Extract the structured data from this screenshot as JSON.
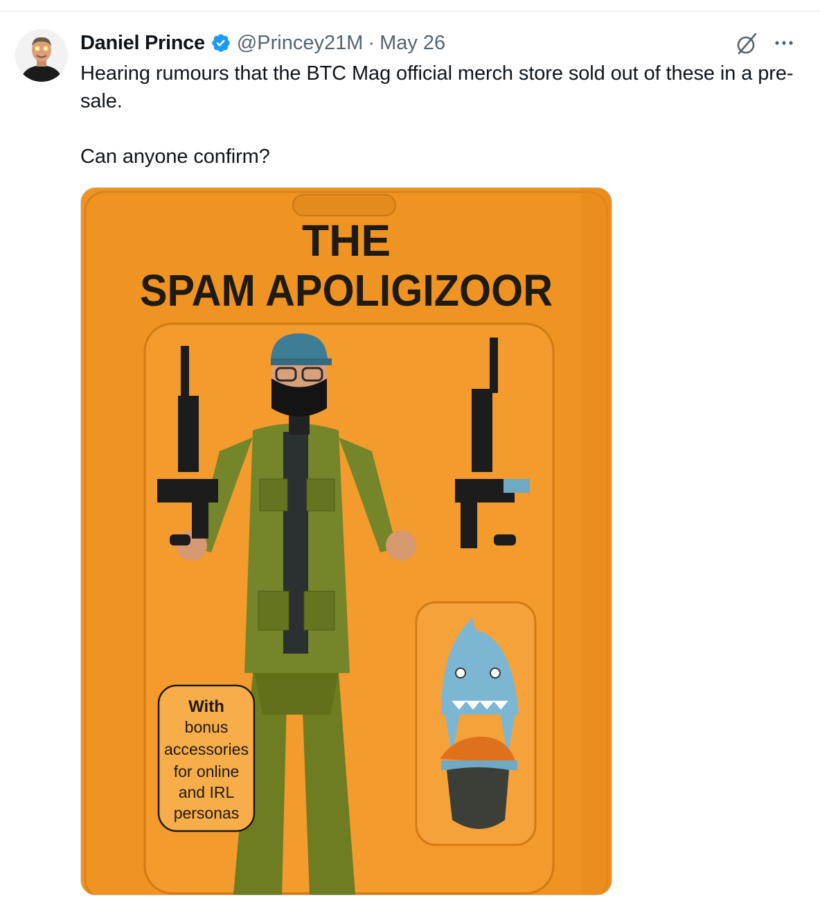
{
  "tweet": {
    "author_name": "Daniel Prince",
    "handle": "@Princey21M",
    "separator": "·",
    "date": "May 26",
    "text_lines": [
      "Hearing rumours that the BTC Mag official merch store sold out of these in a pre-sale.",
      "Can anyone confirm?"
    ]
  },
  "media": {
    "title_line1": "THE",
    "title_line2": "SPAM APOLIGIZOOR",
    "bubble_lines": [
      "With",
      "bonus",
      "accessories",
      "for online",
      "and IRL",
      "personas"
    ]
  },
  "icons": {
    "verified": "verified-badge-icon",
    "grok": "grok-icon",
    "more": "more-horizontal-icon"
  },
  "colors": {
    "verified_blue": "#1d9bf0",
    "text_secondary": "#536471",
    "card_orange": "#ef9422"
  }
}
